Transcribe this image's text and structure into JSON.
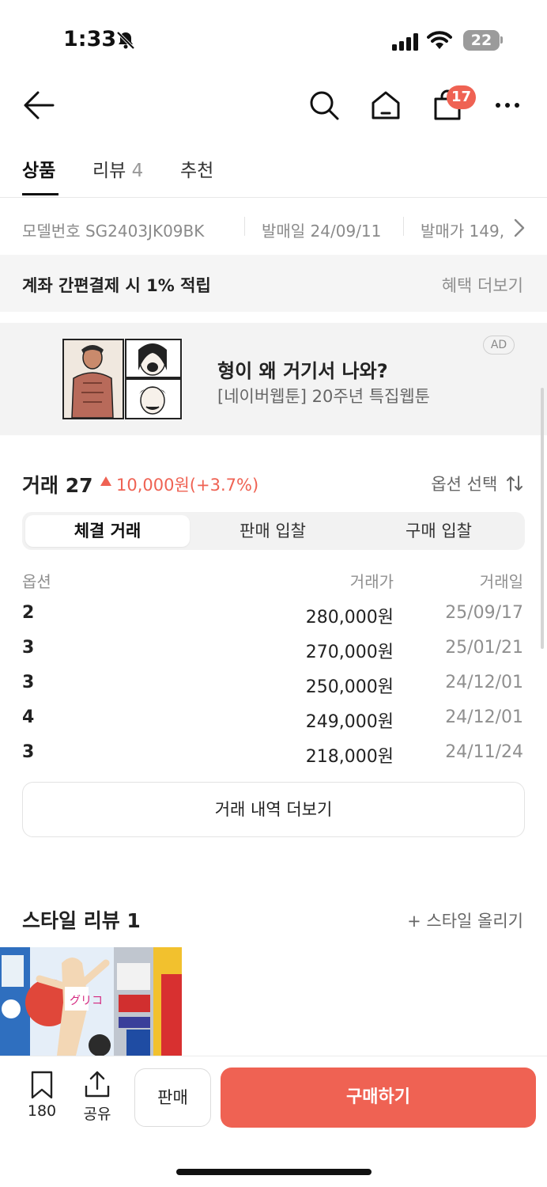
{
  "status_bar": {
    "time": "1:33",
    "battery": "22",
    "icons": [
      "bell-slash-icon",
      "signal-icon",
      "wifi-icon",
      "battery-icon"
    ]
  },
  "header": {
    "icons": [
      "back-arrow-icon",
      "search-icon",
      "home-icon",
      "shopping-bag-icon",
      "more-icon"
    ],
    "cart_badge": "17"
  },
  "tabs": [
    {
      "label": "상품",
      "count": ""
    },
    {
      "label": "리뷰",
      "count": "4"
    },
    {
      "label": "추천",
      "count": ""
    }
  ],
  "specs": {
    "model": "모델번호 SG2403JK09BK",
    "release_date": "발매일 24/09/11",
    "release_price": "발매가 149,"
  },
  "benefit": {
    "text": "계좌 간편결제 시 1% 적립",
    "more": "혜택 더보기"
  },
  "ad": {
    "title": "형이 왜 거기서 나와?",
    "subtitle": "[네이버웹툰] 20주년 특집웹툰",
    "badge": "AD"
  },
  "trades": {
    "title": "거래 27",
    "change": "10,000원(+3.7%)",
    "option_select": "옵션 선택",
    "segments": [
      "체결 거래",
      "판매 입찰",
      "구매 입찰"
    ],
    "active_segment": 0,
    "columns": [
      "옵션",
      "거래가",
      "거래일"
    ],
    "rows": [
      {
        "option": "2",
        "price": "280,000원",
        "date": "25/09/17"
      },
      {
        "option": "3",
        "price": "270,000원",
        "date": "25/01/21"
      },
      {
        "option": "3",
        "price": "250,000원",
        "date": "24/12/01"
      },
      {
        "option": "4",
        "price": "249,000원",
        "date": "24/12/01"
      },
      {
        "option": "3",
        "price": "218,000원",
        "date": "24/11/24"
      }
    ],
    "more_button": "거래 내역 더보기"
  },
  "style_review": {
    "title": "스타일 리뷰 1",
    "upload": "+ 스타일 올리기"
  },
  "bottom": {
    "bookmark_count": "180",
    "share_label": "공유",
    "sell_label": "판매",
    "buy_label": "구매하기"
  },
  "colors": {
    "accent": "#ef6253",
    "muted": "#8f8f8f"
  }
}
